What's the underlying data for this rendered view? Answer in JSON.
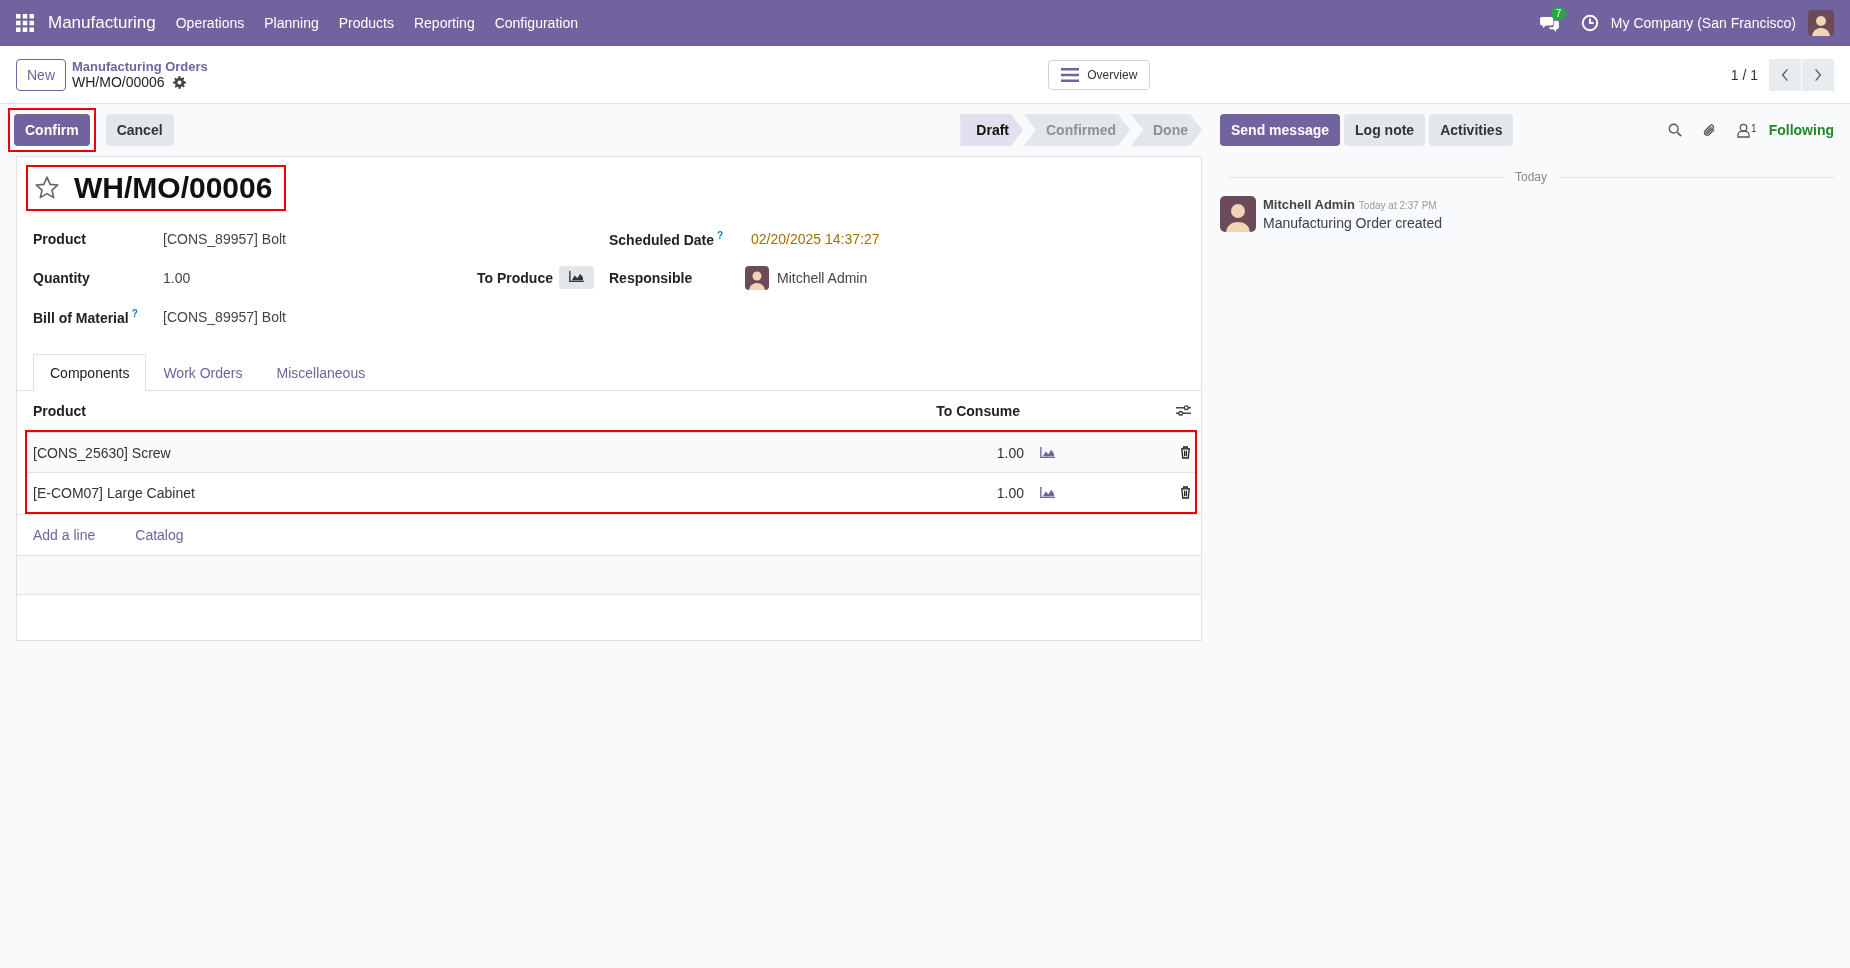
{
  "navbar": {
    "app": "Manufacturing",
    "menu": [
      "Operations",
      "Planning",
      "Products",
      "Reporting",
      "Configuration"
    ],
    "message_count": "7",
    "company": "My Company (San Francisco)"
  },
  "control_panel": {
    "new_button": "New",
    "breadcrumb": "Manufacturing Orders",
    "record": "WH/MO/00006",
    "overview_button": "Overview",
    "pager": "1 / 1"
  },
  "actions": [
    {
      "label": "Confirm",
      "primary": true,
      "highlighted": true
    },
    {
      "label": "Cancel",
      "primary": false,
      "highlighted": false
    }
  ],
  "stages": [
    {
      "label": "Draft",
      "selected": true
    },
    {
      "label": "Confirmed",
      "selected": false
    },
    {
      "label": "Done",
      "selected": false
    }
  ],
  "form": {
    "title": "WH/MO/00006",
    "favorite": false,
    "title_highlighted": true,
    "product_label": "Product",
    "product": "[CONS_89957] Bolt",
    "quantity_label": "Quantity",
    "quantity": "1.00",
    "to_produce_label": "To Produce",
    "bom_label": "Bill of Material",
    "bom_help": "?",
    "bom": "[CONS_89957] Bolt",
    "date_label": "Scheduled Date",
    "date_help": "?",
    "date": "02/20/2025 14:37:27",
    "responsible_label": "Responsible",
    "responsible": "Mitchell Admin"
  },
  "tabs": [
    {
      "label": "Components",
      "selected": true
    },
    {
      "label": "Work Orders",
      "selected": false
    },
    {
      "label": "Miscellaneous",
      "selected": false
    }
  ],
  "table": {
    "columns": [
      "Product",
      "To Consume"
    ],
    "rows_highlighted": true,
    "rows": [
      {
        "product": "[CONS_25630] Screw",
        "to_consume": "1.00"
      },
      {
        "product": "[E-COM07] Large Cabinet",
        "to_consume": "1.00"
      }
    ],
    "links": [
      "Add a line",
      "Catalog"
    ]
  },
  "chatter": {
    "buttons": [
      {
        "label": "Send message",
        "primary": true
      },
      {
        "label": "Log note",
        "primary": false
      },
      {
        "label": "Activities",
        "primary": false
      }
    ],
    "follower_count": "1",
    "following": "Following",
    "date_separator": "Today",
    "messages": [
      {
        "author": "Mitchell Admin",
        "time": "Today at 2:37 PM",
        "body": "Manufacturing Order created"
      }
    ]
  }
}
